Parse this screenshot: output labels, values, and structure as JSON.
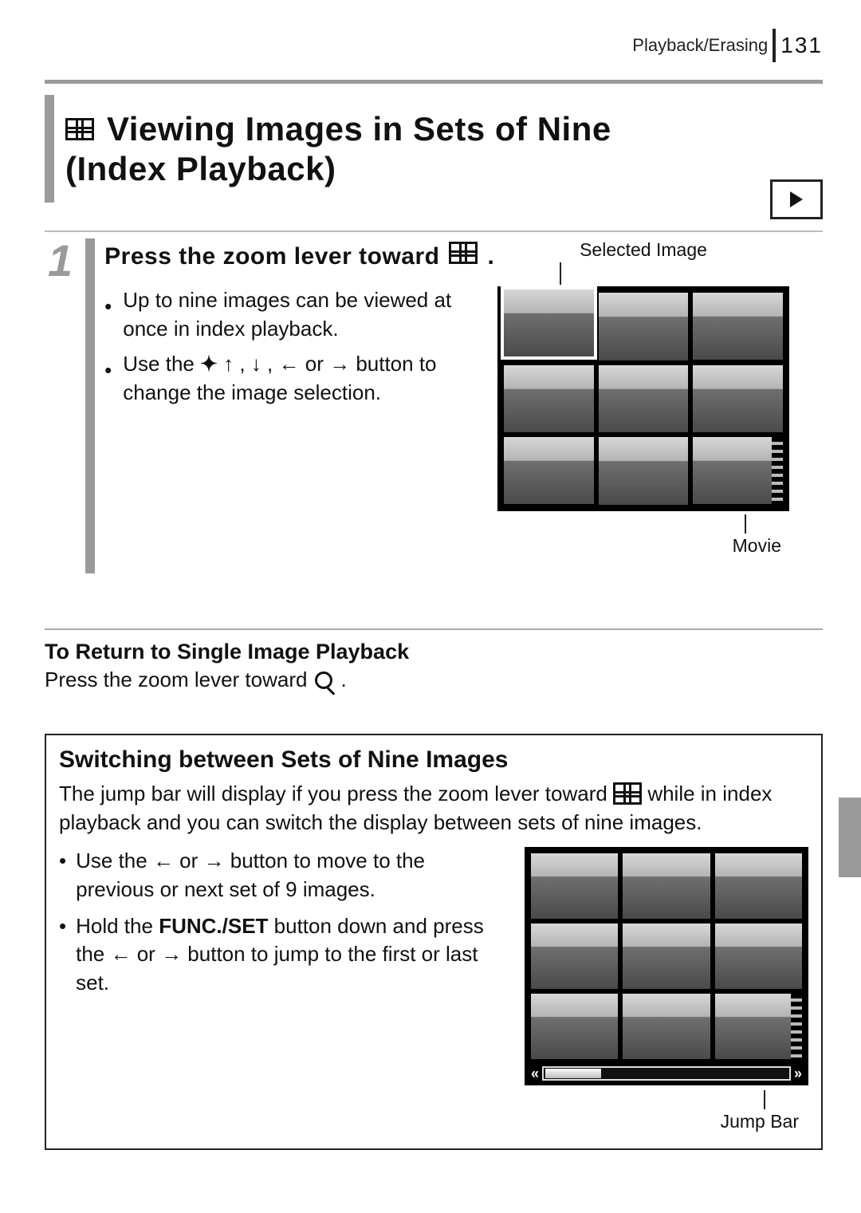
{
  "header": {
    "section": "Playback/Erasing",
    "page_number": "131"
  },
  "title": {
    "line1": "Viewing Images in Sets of Nine",
    "line2": "(Index Playback)"
  },
  "step": {
    "number": "1",
    "heading_prefix": "Press the zoom lever toward",
    "heading_suffix": ".",
    "bullets": [
      "Up to nine images can be viewed at once in index playback.",
      "Use the        ,        ,        or        button to change the image selection."
    ],
    "bullet1": "Up to nine images can be viewed at once in index playback.",
    "bullet2_pre": "Use the ",
    "bullet2_mid1": ", ",
    "bullet2_mid2": ", ",
    "bullet2_mid3": " or ",
    "bullet2_post": " button to change the image selection."
  },
  "preview": {
    "selected_label": "Selected Image",
    "movie_label": "Movie"
  },
  "return_block": {
    "heading": "To Return to Single Image Playback",
    "text_pre": "Press the zoom lever toward ",
    "text_post": "."
  },
  "box": {
    "heading": "Switching between Sets of Nine Images",
    "para_pre": "The jump bar will display if you press the zoom lever toward ",
    "para_post": " while in index playback and you can switch the display between sets of nine images.",
    "b1_pre": "Use the ",
    "b1_mid": " or ",
    "b1_post": " button to move to the previous or next set of 9 images.",
    "b2_pre": "Hold the ",
    "b2_func": "FUNC./SET",
    "b2_mid1": " button down and press the ",
    "b2_mid2": " or ",
    "b2_post": " button to jump to the first or last set.",
    "jump_label": "Jump Bar"
  }
}
